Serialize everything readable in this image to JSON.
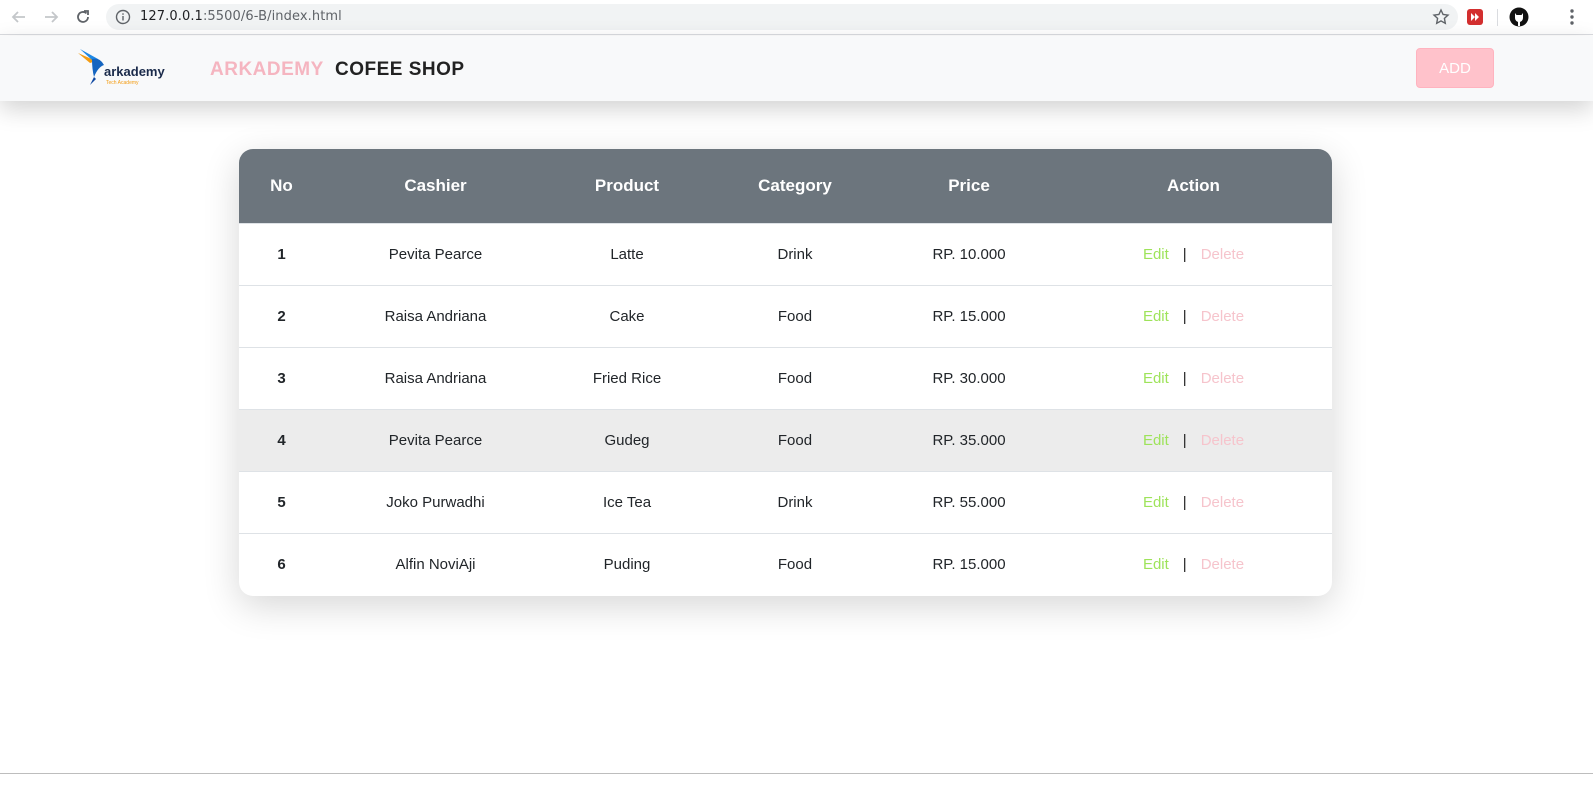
{
  "browser": {
    "url_host": "127.0.0.1",
    "url_rest": ":5500/6-B/index.html"
  },
  "navbar": {
    "brand_accent": "ARKADEMY",
    "brand_main": "COFEE SHOP",
    "add_label": "ADD",
    "logo_text": "arkademy",
    "logo_subtext": "Tech Academy"
  },
  "table": {
    "headers": [
      "No",
      "Cashier",
      "Product",
      "Category",
      "Price",
      "Action"
    ],
    "edit_label": "Edit",
    "separator": "|",
    "delete_label": "Delete",
    "rows": [
      {
        "no": "1",
        "cashier": "Pevita Pearce",
        "product": "Latte",
        "category": "Drink",
        "price": "RP. 10.000"
      },
      {
        "no": "2",
        "cashier": "Raisa Andriana",
        "product": "Cake",
        "category": "Food",
        "price": "RP. 15.000"
      },
      {
        "no": "3",
        "cashier": "Raisa Andriana",
        "product": "Fried Rice",
        "category": "Food",
        "price": "RP. 30.000"
      },
      {
        "no": "4",
        "cashier": "Pevita Pearce",
        "product": "Gudeg",
        "category": "Food",
        "price": "RP. 35.000"
      },
      {
        "no": "5",
        "cashier": "Joko Purwadhi",
        "product": "Ice Tea",
        "category": "Drink",
        "price": "RP. 55.000"
      },
      {
        "no": "6",
        "cashier": "Alfin NoviAji",
        "product": "Puding",
        "category": "Food",
        "price": "RP. 15.000"
      }
    ]
  },
  "colors": {
    "header_bg": "#6c757d",
    "brand_accent": "#f5b5c0",
    "edit": "#9ee35a",
    "delete": "#f6c4cc",
    "add_button": "#ffc2cb"
  },
  "icons": {
    "back": "arrow-left-icon",
    "forward": "arrow-right-icon",
    "reload": "reload-icon",
    "info": "info-icon",
    "bookmark": "star-icon",
    "extension1": "red-play-extension-icon",
    "extension2": "github-cat-icon",
    "menu": "three-dots-menu-icon"
  }
}
